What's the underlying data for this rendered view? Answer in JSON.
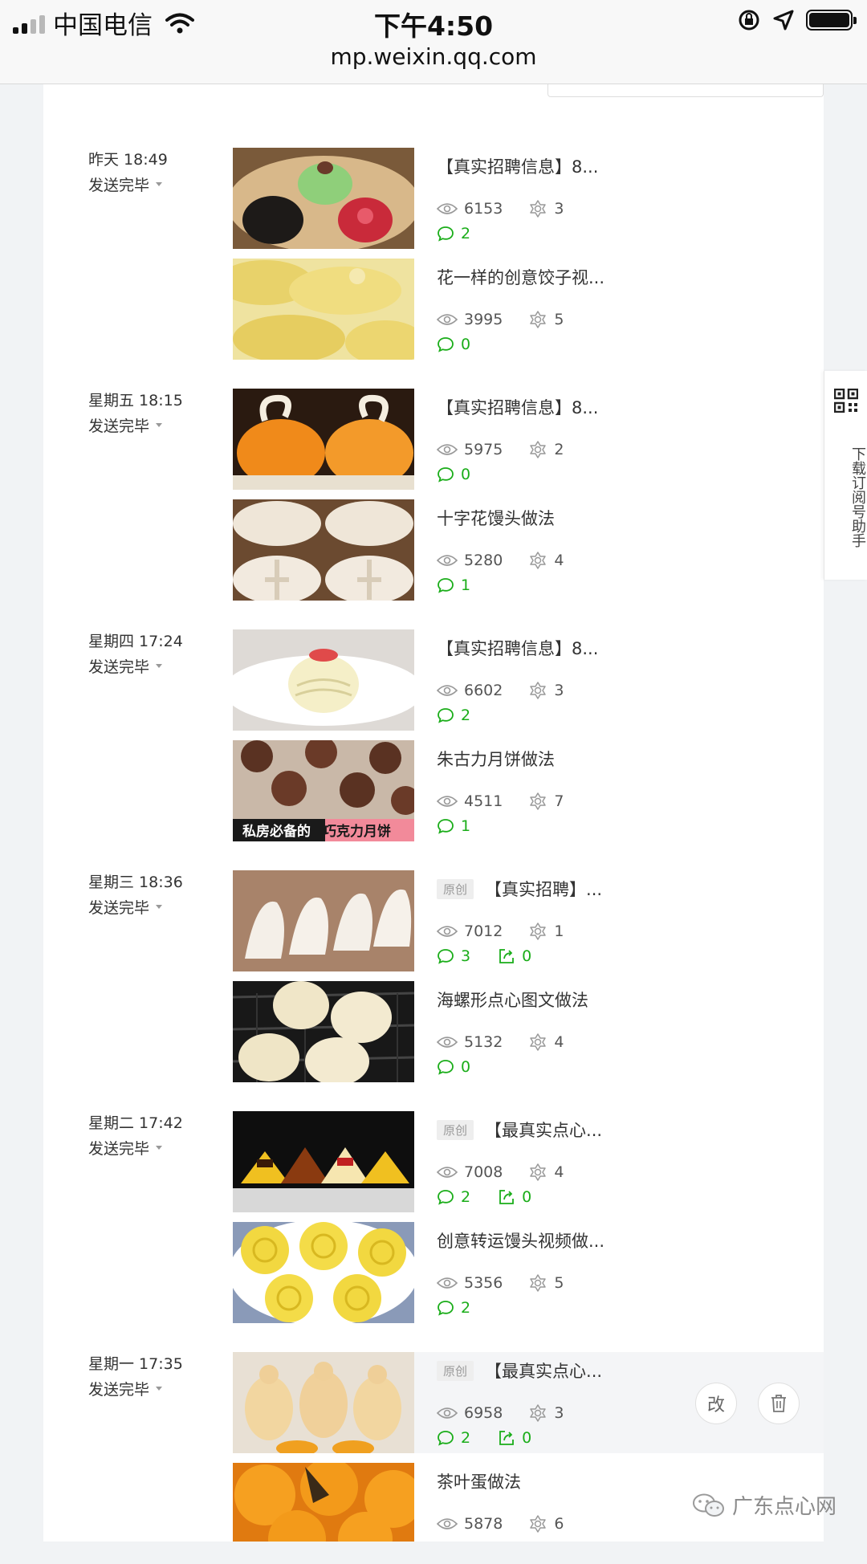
{
  "status_bar": {
    "carrier": "中国电信",
    "time": "下午4:50",
    "url": "mp.weixin.qq.com"
  },
  "groups": [
    {
      "date": "昨天 18:49",
      "status": "发送完毕",
      "items": [
        {
          "title": "【真实招聘信息】8...",
          "original": false,
          "views": "6153",
          "likes": "3",
          "comments": "2",
          "shares": null
        },
        {
          "title": "花一样的创意饺子视...",
          "original": false,
          "views": "3995",
          "likes": "5",
          "comments": "0",
          "shares": null
        }
      ]
    },
    {
      "date": "星期五 18:15",
      "status": "发送完毕",
      "items": [
        {
          "title": "【真实招聘信息】8...",
          "original": false,
          "views": "5975",
          "likes": "2",
          "comments": "0",
          "shares": null
        },
        {
          "title": "十字花馒头做法",
          "original": false,
          "views": "5280",
          "likes": "4",
          "comments": "1",
          "shares": null
        }
      ]
    },
    {
      "date": "星期四 17:24",
      "status": "发送完毕",
      "items": [
        {
          "title": "【真实招聘信息】8...",
          "original": false,
          "views": "6602",
          "likes": "3",
          "comments": "2",
          "shares": null
        },
        {
          "title": "朱古力月饼做法",
          "original": false,
          "views": "4511",
          "likes": "7",
          "comments": "1",
          "shares": null,
          "thumb_caption_a": "私房必备的",
          "thumb_caption_b": "巧克力月饼"
        }
      ]
    },
    {
      "date": "星期三 18:36",
      "status": "发送完毕",
      "items": [
        {
          "title": "【真实招聘】...",
          "original": true,
          "views": "7012",
          "likes": "1",
          "comments": "3",
          "shares": "0"
        },
        {
          "title": "海螺形点心图文做法",
          "original": false,
          "views": "5132",
          "likes": "4",
          "comments": "0",
          "shares": null
        }
      ]
    },
    {
      "date": "星期二 17:42",
      "status": "发送完毕",
      "items": [
        {
          "title": "【最真实点心...",
          "original": true,
          "views": "7008",
          "likes": "4",
          "comments": "2",
          "shares": "0"
        },
        {
          "title": "创意转运馒头视频做...",
          "original": false,
          "views": "5356",
          "likes": "5",
          "comments": "2",
          "shares": null
        }
      ]
    },
    {
      "date": "星期一 17:35",
      "status": "发送完毕",
      "items": [
        {
          "title": "【最真实点心...",
          "original": true,
          "views": "6958",
          "likes": "3",
          "comments": "2",
          "shares": "0"
        },
        {
          "title": "茶叶蛋做法",
          "original": false,
          "views": "5878",
          "likes": "6",
          "comments": null,
          "shares": null
        }
      ]
    }
  ],
  "original_tag": "原创",
  "actions": {
    "edit_label": "改"
  },
  "side_helper": {
    "label": "下载订阅号助手"
  },
  "watermark": {
    "text": "广东点心网"
  },
  "colors": {
    "accent_green": "#1aad19",
    "text": "#333333",
    "muted": "#999999"
  }
}
